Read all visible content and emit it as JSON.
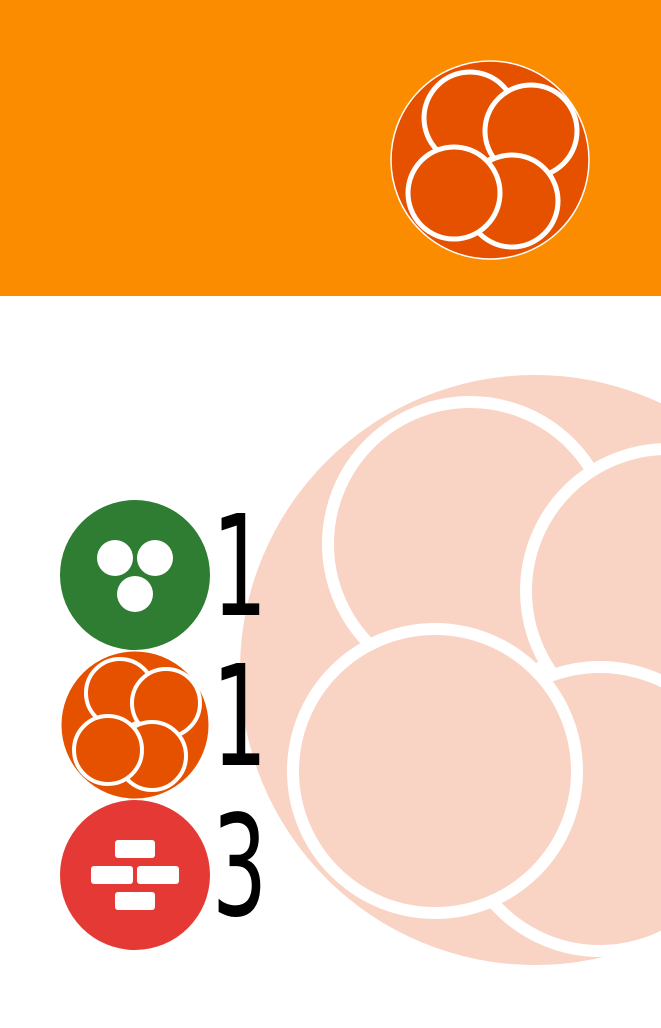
{
  "header": {
    "background_color": "#fb8c00",
    "logo_icon": "cell-cluster-icon",
    "logo_color": "#e65100"
  },
  "watermark": {
    "icon": "cell-cluster-icon",
    "color": "#f9d3c3"
  },
  "stats": [
    {
      "icon": "three-dots-cell-icon",
      "color": "#2e7d32",
      "count": "1"
    },
    {
      "icon": "cell-cluster-icon",
      "color": "#e65100",
      "count": "1"
    },
    {
      "icon": "brick-blocks-icon",
      "color": "#e53935",
      "count": "3"
    }
  ]
}
